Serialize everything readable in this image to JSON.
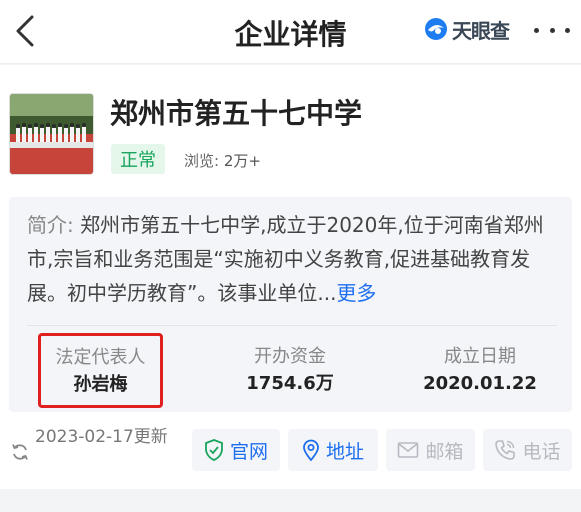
{
  "header": {
    "title": "企业详情",
    "brand": "天眼查"
  },
  "company": {
    "name": "郑州市第五十七中学",
    "status": "正常",
    "views_label": "浏览:",
    "views_value": "2万+"
  },
  "intro": {
    "prefix": "简介:",
    "text": "郑州市第五十七中学,成立于2020年,位于河南省郑州市,宗旨和业务范围是“实施初中义务教育,促进基础教育发展。初中学历教育”。该事业单位...",
    "more": "更多"
  },
  "stats": [
    {
      "label": "法定代表人",
      "value": "孙岩梅"
    },
    {
      "label": "开办资金",
      "value": "1754.6万"
    },
    {
      "label": "成立日期",
      "value": "2020.01.22"
    }
  ],
  "footer": {
    "updated": "2023-02-17更新",
    "actions": [
      {
        "label": "官网",
        "icon": "shield-check-icon",
        "enabled": true
      },
      {
        "label": "地址",
        "icon": "location-pin-icon",
        "enabled": true
      },
      {
        "label": "邮箱",
        "icon": "mail-icon",
        "enabled": false
      },
      {
        "label": "电话",
        "icon": "phone-icon",
        "enabled": false
      }
    ]
  },
  "colors": {
    "accent": "#1e6ff0",
    "status_green": "#17a45c",
    "highlight_red": "#e0201e"
  }
}
